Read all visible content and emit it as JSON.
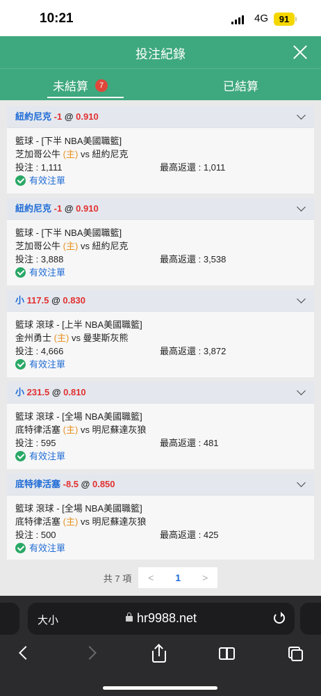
{
  "status": {
    "time": "10:21",
    "network": "4G",
    "battery": "91"
  },
  "header": {
    "title": "投注紀錄"
  },
  "tabs": [
    {
      "label": "未結算",
      "badge": "7"
    },
    {
      "label": "已結算"
    }
  ],
  "bets": [
    {
      "team": "紐約尼克",
      "handicap": "-1",
      "at": "@",
      "odds": "0.910",
      "league": "籃球 - [下半 NBA美國職籃]",
      "home": "芝加哥公牛",
      "host": "(主)",
      "vs": "vs 紐約尼克",
      "stake": "投注 : 1,111",
      "payout": "最高返還 : 1,011",
      "status": "有效注單"
    },
    {
      "team": "紐約尼克",
      "handicap": "-1",
      "at": "@",
      "odds": "0.910",
      "league": "籃球 - [下半 NBA美國職籃]",
      "home": "芝加哥公牛",
      "host": "(主)",
      "vs": "vs 紐約尼克",
      "stake": "投注 : 3,888",
      "payout": "最高返還 : 3,538",
      "status": "有效注單"
    },
    {
      "team": "小",
      "handicap": "117.5",
      "at": "@",
      "odds": "0.830",
      "league": "籃球 滾球 - [上半 NBA美國職籃]",
      "home": "金州勇士",
      "host": "(主)",
      "vs": "vs 曼斐斯灰熊",
      "stake": "投注 : 4,666",
      "payout": "最高返還 : 3,872",
      "status": "有效注單"
    },
    {
      "team": "小",
      "handicap": "231.5",
      "at": "@",
      "odds": "0.810",
      "league": "籃球 滾球 - [全場 NBA美國職籃]",
      "home": "底特律活塞",
      "host": "(主)",
      "vs": "vs 明尼蘇達灰狼",
      "stake": "投注 : 595",
      "payout": "最高返還 : 481",
      "status": "有效注單"
    },
    {
      "team": "底特律活塞",
      "handicap": "-8.5",
      "at": "@",
      "odds": "0.850",
      "league": "籃球 滾球 - [全場 NBA美國職籃]",
      "home": "底特律活塞",
      "host": "(主)",
      "vs": "vs 明尼蘇達灰狼",
      "stake": "投注 : 500",
      "payout": "最高返還 : 425",
      "status": "有效注單"
    }
  ],
  "pager": {
    "total": "共 7 項",
    "prev": "<",
    "page": "1",
    "next": ">"
  },
  "safari": {
    "text_size": "大小",
    "url": "hr9988.net"
  }
}
